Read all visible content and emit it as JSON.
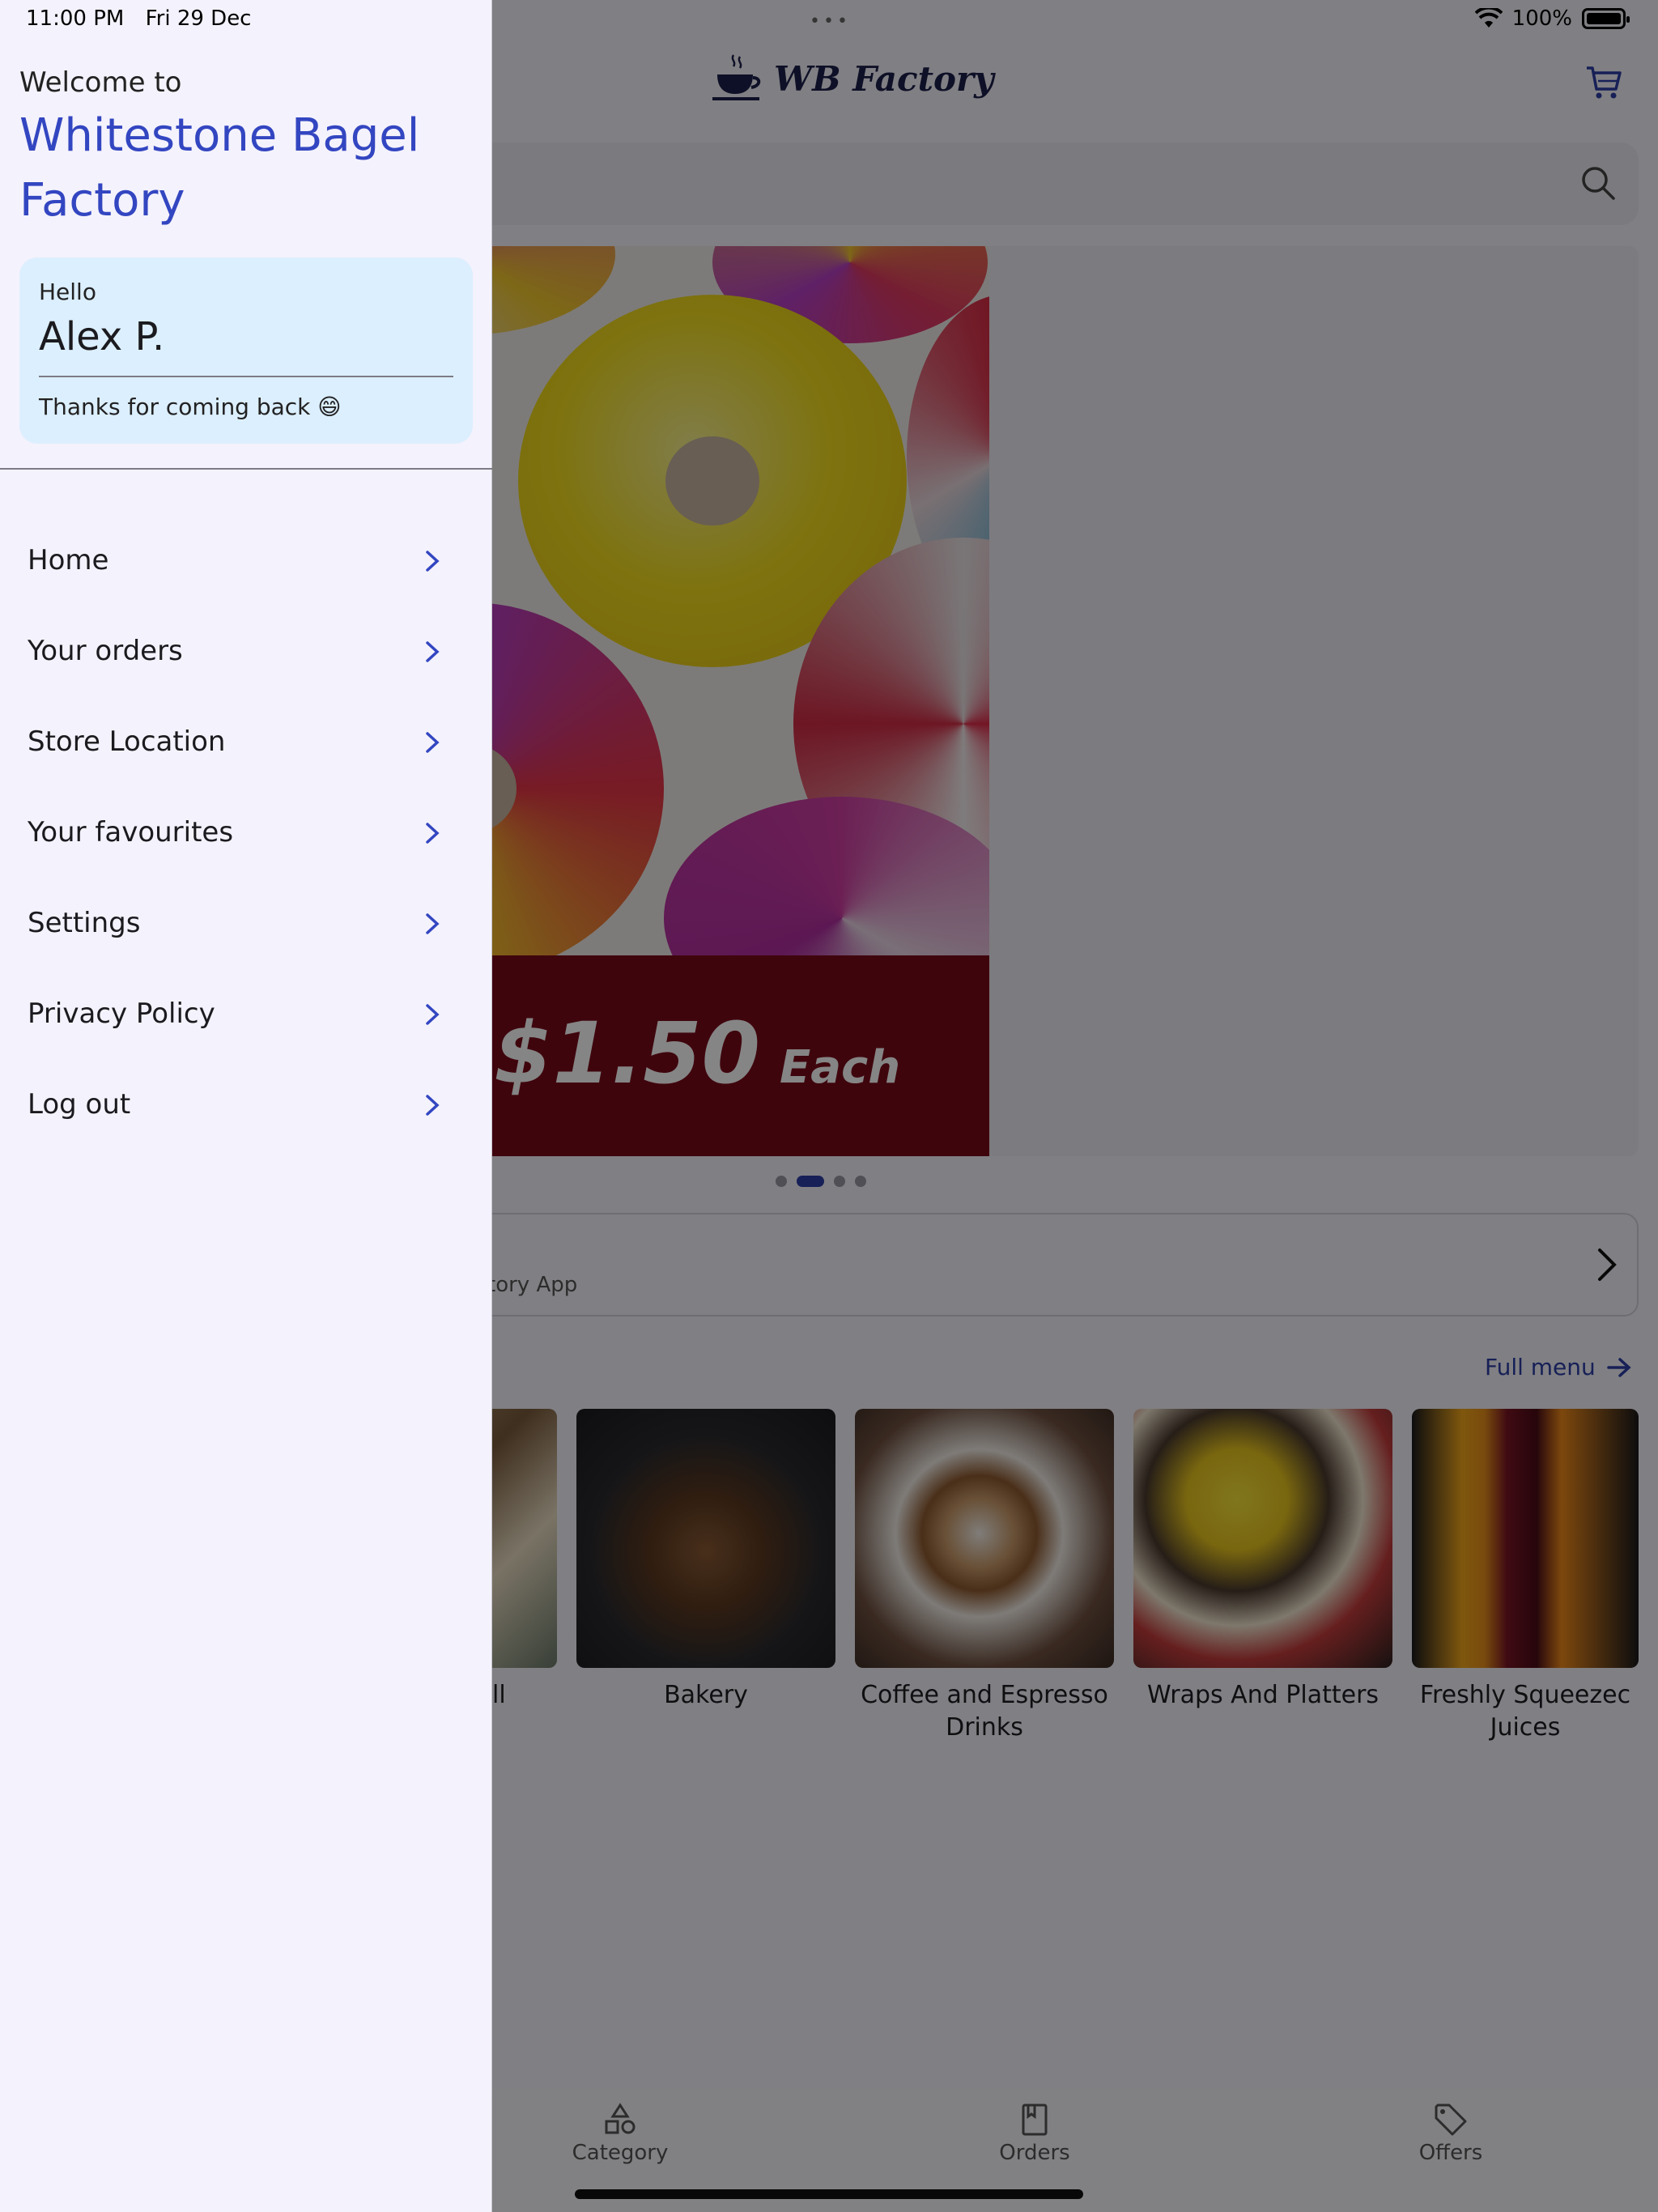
{
  "status_bar": {
    "time": "11:00 PM",
    "date": "Fri 29 Dec",
    "dots": "•••",
    "battery": "100%"
  },
  "header": {
    "logo_text": "WB Factory"
  },
  "hero": {
    "price": "$1.50",
    "each": "Each"
  },
  "info_card": {
    "subtitle": "tory App"
  },
  "menu_section": {
    "full_menu_label": "Full menu"
  },
  "categories": [
    {
      "label": "ll"
    },
    {
      "label": "Bakery"
    },
    {
      "label": "Coffee and Espresso Drinks"
    },
    {
      "label": "Wraps And Platters"
    },
    {
      "label": "Freshly Squeezec Juices"
    }
  ],
  "bottom_nav": [
    {
      "label": "Category",
      "icon": "category-icon"
    },
    {
      "label": "Orders",
      "icon": "orders-icon"
    },
    {
      "label": "Offers",
      "icon": "offers-icon"
    }
  ],
  "drawer": {
    "welcome": "Welcome to",
    "brand": "Whitestone Bagel Factory",
    "user_card": {
      "hello": "Hello",
      "name": "Alex P.",
      "thanks": "Thanks for coming back 😄"
    },
    "items": [
      {
        "label": "Home"
      },
      {
        "label": "Your orders"
      },
      {
        "label": "Store Location"
      },
      {
        "label": "Your favourites"
      },
      {
        "label": "Settings"
      },
      {
        "label": "Privacy Policy"
      },
      {
        "label": "Log out"
      }
    ]
  },
  "colors": {
    "accent": "#3346c1",
    "drawer_bg": "#f4f2fc",
    "user_card_bg": "#dcefff",
    "banner_bg": "#7a0b1a"
  }
}
